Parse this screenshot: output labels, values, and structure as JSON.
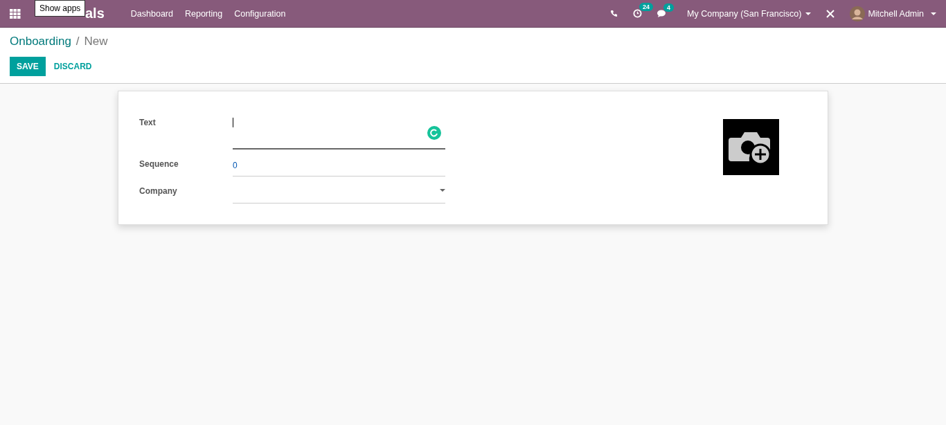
{
  "navbar": {
    "app_name": "als",
    "tooltip": "Show apps",
    "menu": [
      "Dashboard",
      "Reporting",
      "Configuration"
    ],
    "activity_count": "24",
    "message_count": "4",
    "company": "My Company (San Francisco)",
    "user": "Mitchell Admin"
  },
  "breadcrumb": {
    "parent": "Onboarding",
    "separator": "/",
    "current": "New"
  },
  "buttons": [
    {
      "label": "SAVE",
      "kind": "primary"
    },
    {
      "label": "DISCARD",
      "kind": "link"
    }
  ],
  "form": {
    "fields": [
      {
        "label": "Text",
        "kind": "textarea",
        "focused": true
      },
      {
        "label": "Sequence",
        "kind": "input",
        "value": "0",
        "focused": false
      },
      {
        "label": "Company",
        "kind": "select",
        "focused": false
      }
    ]
  }
}
